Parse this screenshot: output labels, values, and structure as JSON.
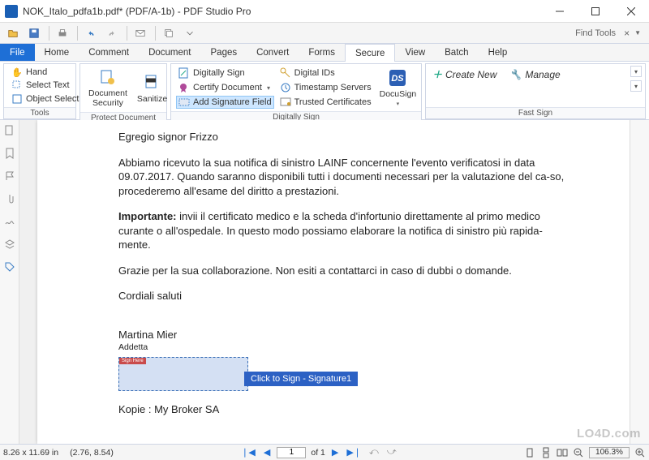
{
  "window": {
    "title": "NOK_Italo_pdfa1b.pdf* (PDF/A-1b) - PDF Studio Pro",
    "find_tools": "Find Tools"
  },
  "tabs": {
    "file": "File",
    "home": "Home",
    "comment": "Comment",
    "document": "Document",
    "pages": "Pages",
    "convert": "Convert",
    "forms": "Forms",
    "secure": "Secure",
    "view": "View",
    "batch": "Batch",
    "help": "Help"
  },
  "ribbon": {
    "tools": {
      "hand": "Hand",
      "select_text": "Select Text",
      "object_select": "Object Select",
      "title": "Tools"
    },
    "protect": {
      "doc_security": "Document\nSecurity",
      "sanitize": "Sanitize",
      "title": "Protect Document"
    },
    "digitally_sign": {
      "sign": "Digitally Sign",
      "certify": "Certify Document",
      "add_sig": "Add Signature Field",
      "digital_ids": "Digital IDs",
      "timestamp": "Timestamp Servers",
      "trusted": "Trusted Certificates",
      "docusign": "DocuSign",
      "title": "Digitally Sign"
    },
    "fast_sign": {
      "create_new": "Create New",
      "manage": "Manage",
      "title": "Fast Sign"
    }
  },
  "doc": {
    "p1": "Egregio signor Frizzo",
    "p2": "Abbiamo ricevuto la sua notifica di sinistro LAINF concernente l'evento verificatosi in data 09.07.2017. Quando saranno disponibili tutti i documenti necessari per la valutazione del ca-so, procederemo all'esame del diritto a prestazioni.",
    "p3_bold": "Importante:",
    "p3_rest": " invii il certificato medico e la scheda d'infortunio direttamente al primo medico curante o all'ospedale. In questo modo possiamo elaborare la notifica di sinistro più rapida-mente.",
    "p4": "Grazie per la sua collaborazione. Non esiti a contattarci in caso di dubbi o domande.",
    "p5": "Cordiali saluti",
    "sig_name": "Martina Mier",
    "sig_role": "Addetta",
    "sig_stamp": "Sign Here",
    "sig_tooltip": "Click to Sign - Signature1",
    "kopie": "Kopie : My Broker SA"
  },
  "status": {
    "dim": "8.26 x 11.69 in",
    "coords": "(2.76, 8.54)",
    "page": "1",
    "of": "of 1",
    "zoom": "106.3%"
  },
  "watermark": "LO4D.com"
}
